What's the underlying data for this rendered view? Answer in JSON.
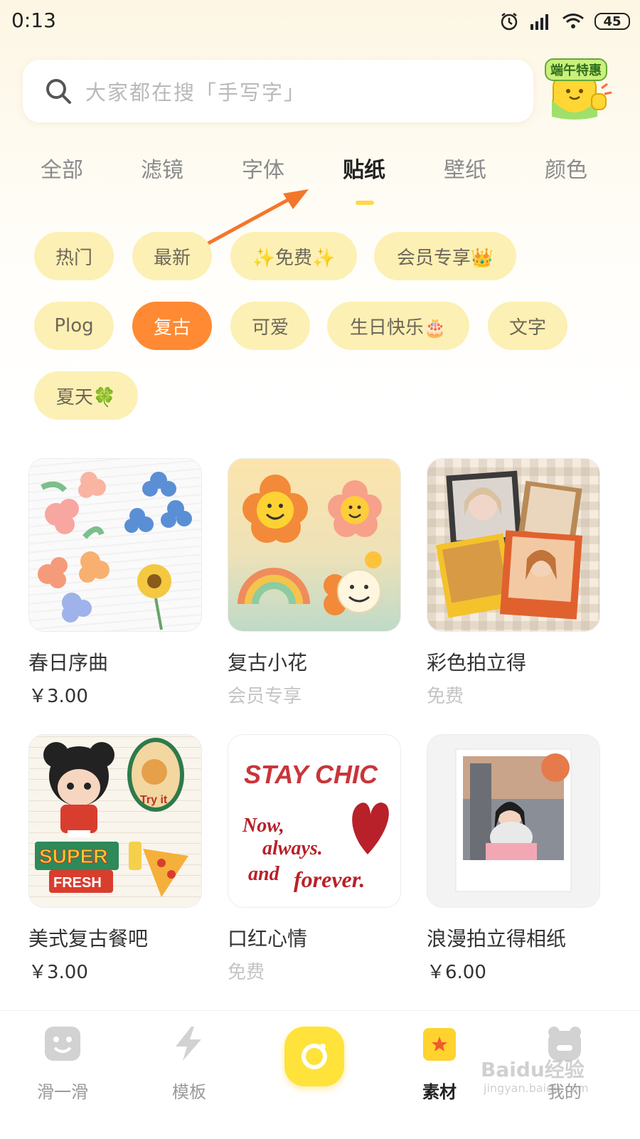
{
  "status_bar": {
    "time": "0:13",
    "battery": "45"
  },
  "search": {
    "placeholder": "大家都在搜「手写字」"
  },
  "promo": {
    "tag": "端午特惠"
  },
  "tabs": [
    "全部",
    "滤镜",
    "字体",
    "贴纸",
    "壁纸",
    "颜色"
  ],
  "active_tab": "贴纸",
  "chips": [
    {
      "label": "热门"
    },
    {
      "label": "最新"
    },
    {
      "label": "✨免费✨"
    },
    {
      "label": "会员专享👑"
    },
    {
      "label": "Plog"
    },
    {
      "label": "复古",
      "active": true
    },
    {
      "label": "可爱"
    },
    {
      "label": "生日快乐🎂"
    },
    {
      "label": "文字"
    },
    {
      "label": "夏天🍀"
    }
  ],
  "cards": [
    {
      "name": "春日序曲",
      "price": "￥3.00",
      "price_type": "paid"
    },
    {
      "name": "复古小花",
      "price": "会员专享",
      "price_type": "member"
    },
    {
      "name": "彩色拍立得",
      "price": "免费",
      "price_type": "free"
    },
    {
      "name": "美式复古餐吧",
      "price": "￥3.00",
      "price_type": "paid",
      "art_text": {
        "tryit": "Try it",
        "super": "SUPER",
        "fresh": "FRESH"
      }
    },
    {
      "name": "口红心情",
      "price": "免费",
      "price_type": "free",
      "art_text": {
        "line1": "STAY CHIC",
        "line2": "Now,",
        "line3": "always.",
        "line4": "and",
        "line5": "forever."
      }
    },
    {
      "name": "浪漫拍立得相纸",
      "price": "￥6.00",
      "price_type": "paid"
    }
  ],
  "bottom_nav": [
    {
      "label": "滑一滑",
      "icon": "face-icon"
    },
    {
      "label": "模板",
      "icon": "lightning-icon"
    },
    {
      "label": "",
      "icon": "camera-icon"
    },
    {
      "label": "素材",
      "icon": "star-bag-icon",
      "active": true
    },
    {
      "label": "我的",
      "icon": "bear-icon"
    }
  ],
  "watermark": {
    "main": "Baidu经验",
    "sub": "jingyan.baidu.com"
  },
  "colors": {
    "accent_orange": "#ff8a33",
    "chip_bg": "#fdf0b4",
    "underline_yellow": "#ffd84a",
    "camera_yellow": "#ffe33a"
  }
}
